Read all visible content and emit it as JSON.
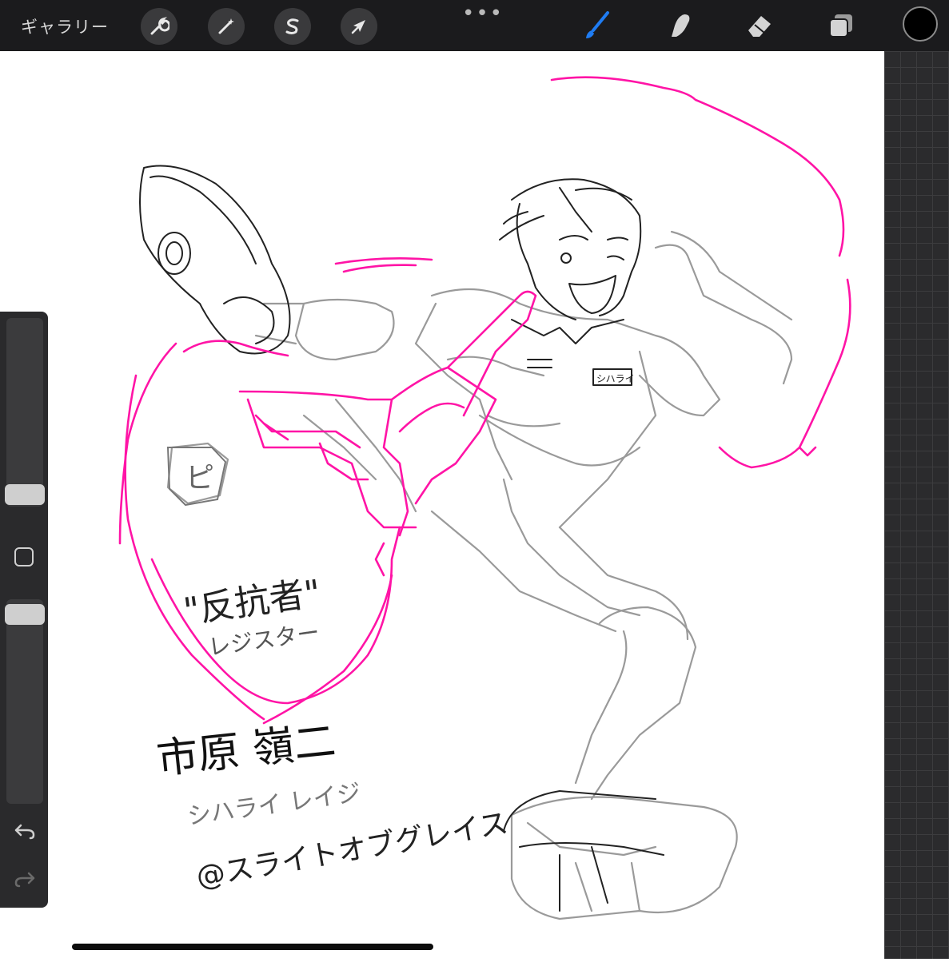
{
  "toolbar": {
    "gallery_label": "ギャラリー",
    "actions_icon": "wrench-icon",
    "adjustments_icon": "magic-wand-icon",
    "selection_icon": "selection-s-icon",
    "transform_icon": "arrow-cursor-icon",
    "more_label": "•••",
    "brush_icon": "brush-icon",
    "smudge_icon": "smudge-icon",
    "eraser_icon": "eraser-icon",
    "layers_icon": "layers-icon",
    "current_color": "#000000",
    "active_tool_color": "#1f7cf2"
  },
  "canvas": {
    "annotation_title": "\"反抗者\"",
    "annotation_reading": "レジスター",
    "name_kanji": "市原 嶺二",
    "name_reading": "シハライ レイジ",
    "faction": "@スライトオブグレイス",
    "name_badge": "シハライ",
    "logo_char": "ピ",
    "sketch_color": "#ff14a6",
    "pencil_color": "#222222",
    "grey_color": "#9a9a9a"
  },
  "sidebar": {
    "brush_size_level": 0.55,
    "opacity_level": 0.9,
    "undo_icon": "undo-icon",
    "redo_icon": "redo-icon",
    "modify_icon": "square-modify-icon"
  }
}
